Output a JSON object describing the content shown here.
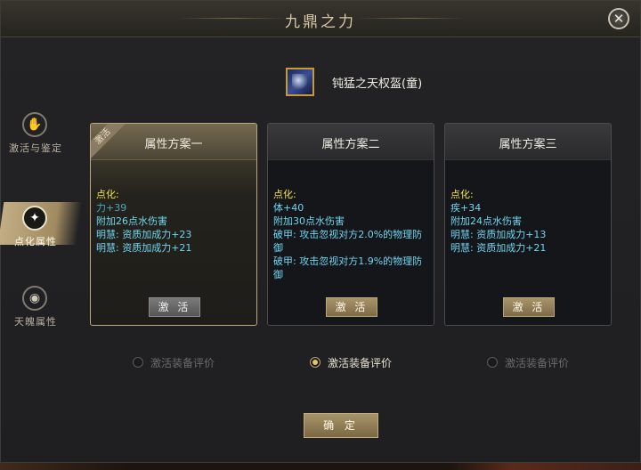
{
  "window": {
    "title": "九鼎之力",
    "close_label": "✕"
  },
  "sidebar": {
    "items": [
      {
        "label": "激活与鉴定",
        "icon": "hand-icon",
        "glyph": "✋"
      },
      {
        "label": "点化属性",
        "icon": "sparkle-icon",
        "glyph": "✦"
      },
      {
        "label": "天魄属性",
        "icon": "eye-icon",
        "glyph": "◉"
      }
    ]
  },
  "item": {
    "name": "钝猛之天权盔(童)",
    "icon": "helmet-icon"
  },
  "cards": [
    {
      "title": "属性方案一",
      "ribbon": "激活",
      "header": "点化:",
      "lines": [
        "力+39",
        "附加26点水伤害",
        "明慧: 资质加成力+23",
        "明慧: 资质加成力+21"
      ],
      "button": "激 活"
    },
    {
      "title": "属性方案二",
      "header": "点化:",
      "lines": [
        "体+40",
        "附加30点水伤害",
        "破甲: 攻击忽视对方2.0%的物理防御",
        "破甲: 攻击忽视对方1.9%的物理防御"
      ],
      "button": "激 活"
    },
    {
      "title": "属性方案三",
      "header": "点化:",
      "lines": [
        "疾+34",
        "附加24点水伤害",
        "明慧: 资质加成力+13",
        "明慧: 资质加成力+21"
      ],
      "button": "激 活"
    }
  ],
  "radios": [
    {
      "label": "激活装备评价",
      "selected": false
    },
    {
      "label": "激活装备评价",
      "selected": true
    },
    {
      "label": "激活装备评价",
      "selected": false
    }
  ],
  "confirm_label": "确 定",
  "colors": {
    "accent_gold": "#b8a478",
    "attr_cyan": "#70d6f0",
    "attr_header_yellow": "#f2e34a"
  }
}
